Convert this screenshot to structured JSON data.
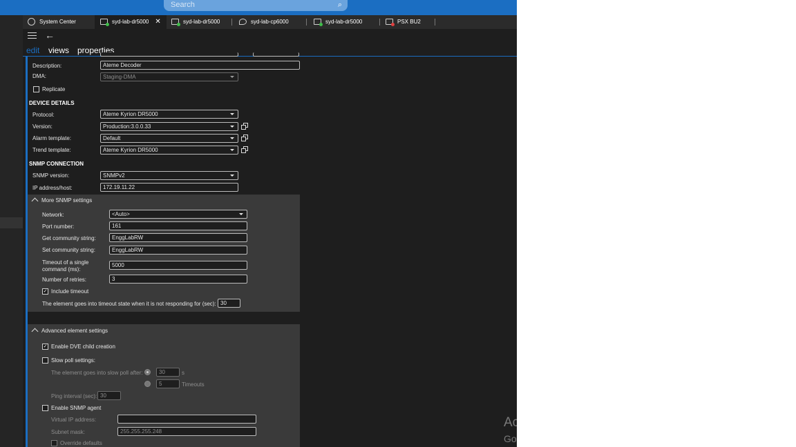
{
  "search": {
    "placeholder": "Search"
  },
  "tabs": [
    {
      "label": "System Center"
    },
    {
      "label": "syd-lab-dr5000",
      "close": "✕"
    },
    {
      "label": "syd-lab-dr5000"
    },
    {
      "label": "syd-lab-cp6000"
    },
    {
      "label": "syd-lab-dr5000"
    },
    {
      "label": "PSX BU2"
    }
  ],
  "menu_tabs": {
    "edit": "edit",
    "views": "views",
    "properties": "properties"
  },
  "general": {
    "description_label": "Description:",
    "description_value": "Ateme Decoder",
    "dma_label": "DMA:",
    "dma_value": "Staging-DMA",
    "replicate_label": "Replicate"
  },
  "device_details": {
    "heading": "DEVICE DETAILS",
    "protocol_label": "Protocol:",
    "protocol_value": "Ateme Kyrion DR5000",
    "version_label": "Version:",
    "version_value": "Production:3.0.0.33",
    "alarm_label": "Alarm template:",
    "alarm_value": "Default",
    "trend_label": "Trend template:",
    "trend_value": "Ateme Kyrion DR5000"
  },
  "snmp": {
    "heading": "SNMP CONNECTION",
    "version_label": "SNMP version:",
    "version_value": "SNMPv2",
    "ip_label": "IP address/host:",
    "ip_value": "172.19.11.22",
    "more_label": "More SNMP settings",
    "network_label": "Network:",
    "network_value": "<Auto>",
    "port_label": "Port number:",
    "port_value": "161",
    "get_label": "Get community string:",
    "get_value": "EnggLabRW",
    "set_label": "Set community string:",
    "set_value": "EnggLabRW",
    "timeout_label_1": "Timeout of a single",
    "timeout_label_2": "command (ms):",
    "timeout_value": "5000",
    "retries_label": "Number of retries:",
    "retries_value": "3",
    "include_timeout_label": "Include timeout",
    "include_timeout_checked": "✓",
    "timeout_state_label": "The element goes into timeout state when it is not responding for (sec):",
    "timeout_state_value": "30"
  },
  "advanced": {
    "heading": "Advanced element settings",
    "dve_label": "Enable DVE child creation",
    "dve_checked": "✓",
    "slow_poll_label": "Slow poll settings:",
    "slow_poll_after_label": "The element goes into slow poll after:",
    "slow_poll_seconds_value": "30",
    "seconds_unit": "s",
    "slow_poll_timeouts_value": "5",
    "timeouts_unit": "Timeouts",
    "ping_label": "Ping interval (sec):",
    "ping_value": "30",
    "snmp_agent_label": "Enable SNMP agent",
    "virtual_ip_label": "Virtual IP address:",
    "virtual_ip_value": "",
    "subnet_label": "Subnet mask:",
    "subnet_value": "255.255.255.248",
    "override_label": "Override defaults"
  },
  "watermark": {
    "line1": "Ac",
    "line2": "Go"
  },
  "colors": {
    "accent": "#1b6ec2",
    "background": "#1e1e1e",
    "panel": "#3a3a3a"
  }
}
